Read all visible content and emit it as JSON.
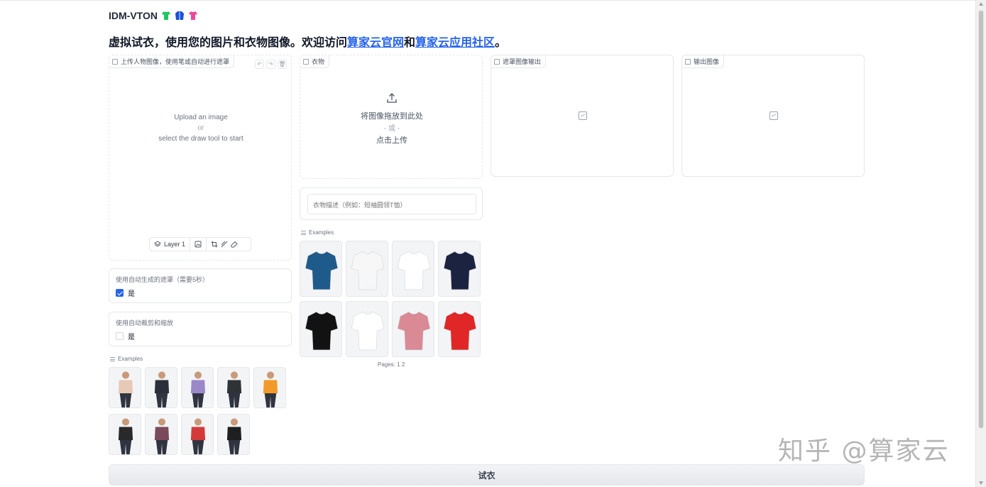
{
  "app": {
    "title": "IDM-VTON",
    "subtitle_prefix": "虚拟试衣，使用您的图片和衣物图像。欢迎访问",
    "link1": "算家云官网",
    "and": "和",
    "link2": "算家云应用社区",
    "suffix": "。"
  },
  "editor": {
    "label": "上传人物图像，使用笔或自动进行遮罩",
    "hint_line1": "Upload an image",
    "hint_or": "or",
    "hint_line2": "select the draw tool to start",
    "layer_label": "Layer 1"
  },
  "auto_mask": {
    "label": "使用自动生成的遮罩（需要5秒）",
    "option": "是",
    "checked": true
  },
  "auto_crop": {
    "label": "使用自动裁剪和缩放",
    "option": "是",
    "checked": false
  },
  "person_examples": {
    "title": "Examples",
    "items": [
      {
        "icon": "person-photo-icon",
        "color": "#e8c9b6"
      },
      {
        "icon": "person-photo-icon",
        "color": "#2b2f3a"
      },
      {
        "icon": "person-photo-icon",
        "color": "#9b88c9"
      },
      {
        "icon": "person-photo-icon",
        "color": "#303336"
      },
      {
        "icon": "person-photo-icon",
        "color": "#f19a2a"
      },
      {
        "icon": "person-photo-icon",
        "color": "#2a2a2a"
      },
      {
        "icon": "person-photo-icon",
        "color": "#7a4a5a"
      },
      {
        "icon": "person-photo-icon",
        "color": "#d43a3a"
      },
      {
        "icon": "person-photo-icon",
        "color": "#1f1f1f"
      }
    ]
  },
  "garment": {
    "label": "衣物",
    "drop_text": "将图像拖放到此处",
    "or_text": "- 或 -",
    "click_text": "点击上传"
  },
  "description": {
    "placeholder": "衣物描述（例如：短袖圆领T恤）"
  },
  "garment_examples": {
    "title": "Examples",
    "items": [
      {
        "icon": "blouse-icon",
        "color": "#1e5a8a"
      },
      {
        "icon": "tshirt-icon",
        "color": "#f7f7f7"
      },
      {
        "icon": "tank-top-icon",
        "color": "#ffffff"
      },
      {
        "icon": "polo-icon",
        "color": "#1c2340"
      },
      {
        "icon": "tshirt-icon",
        "color": "#121212"
      },
      {
        "icon": "tshirt-icon",
        "color": "#ffffff"
      },
      {
        "icon": "cardigan-icon",
        "color": "#d98a94"
      },
      {
        "icon": "tshirt-icon",
        "color": "#e02626"
      }
    ],
    "pages_label": "Pages:",
    "page1": "1",
    "page2": "2"
  },
  "mask_output": {
    "label": "遮罩图像输出"
  },
  "final_output": {
    "label": "输出图像"
  },
  "button": {
    "label": "试衣"
  },
  "watermark": "知乎 @算家云"
}
